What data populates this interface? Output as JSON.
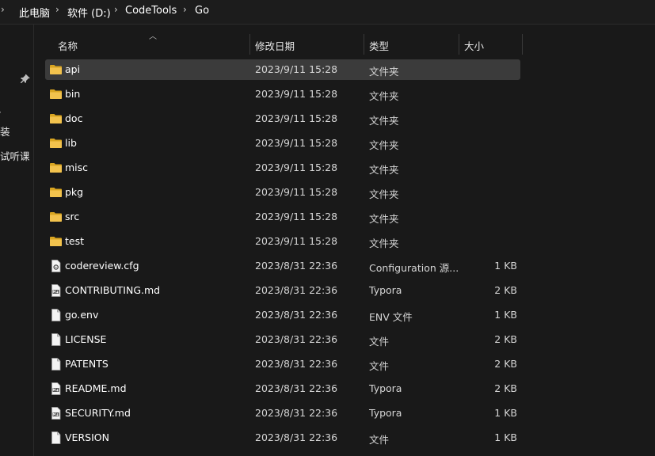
{
  "breadcrumb": {
    "items": [
      "此电脑",
      "软件 (D:)",
      "CodeTools",
      "Go"
    ],
    "separator": "›"
  },
  "left_pane": {
    "items": [
      "装",
      "试听课"
    ]
  },
  "columns": {
    "name": "名称",
    "date": "修改日期",
    "type": "类型",
    "size": "大小"
  },
  "files": [
    {
      "name": "api",
      "date": "2023/9/11 15:28",
      "type": "文件夹",
      "size": "",
      "icon": "folder-icon",
      "selected": true
    },
    {
      "name": "bin",
      "date": "2023/9/11 15:28",
      "type": "文件夹",
      "size": "",
      "icon": "folder-icon"
    },
    {
      "name": "doc",
      "date": "2023/9/11 15:28",
      "type": "文件夹",
      "size": "",
      "icon": "folder-icon"
    },
    {
      "name": "lib",
      "date": "2023/9/11 15:28",
      "type": "文件夹",
      "size": "",
      "icon": "folder-icon"
    },
    {
      "name": "misc",
      "date": "2023/9/11 15:28",
      "type": "文件夹",
      "size": "",
      "icon": "folder-icon"
    },
    {
      "name": "pkg",
      "date": "2023/9/11 15:28",
      "type": "文件夹",
      "size": "",
      "icon": "folder-icon"
    },
    {
      "name": "src",
      "date": "2023/9/11 15:28",
      "type": "文件夹",
      "size": "",
      "icon": "folder-icon"
    },
    {
      "name": "test",
      "date": "2023/9/11 15:28",
      "type": "文件夹",
      "size": "",
      "icon": "folder-icon"
    },
    {
      "name": "codereview.cfg",
      "date": "2023/8/31 22:36",
      "type": "Configuration 源...",
      "size": "1 KB",
      "icon": "config-file-icon"
    },
    {
      "name": "CONTRIBUTING.md",
      "date": "2023/8/31 22:36",
      "type": "Typora",
      "size": "2 KB",
      "icon": "markdown-file-icon"
    },
    {
      "name": "go.env",
      "date": "2023/8/31 22:36",
      "type": "ENV 文件",
      "size": "1 KB",
      "icon": "file-icon"
    },
    {
      "name": "LICENSE",
      "date": "2023/8/31 22:36",
      "type": "文件",
      "size": "2 KB",
      "icon": "file-icon"
    },
    {
      "name": "PATENTS",
      "date": "2023/8/31 22:36",
      "type": "文件",
      "size": "2 KB",
      "icon": "file-icon"
    },
    {
      "name": "README.md",
      "date": "2023/8/31 22:36",
      "type": "Typora",
      "size": "2 KB",
      "icon": "markdown-file-icon"
    },
    {
      "name": "SECURITY.md",
      "date": "2023/8/31 22:36",
      "type": "Typora",
      "size": "1 KB",
      "icon": "markdown-file-icon"
    },
    {
      "name": "VERSION",
      "date": "2023/8/31 22:36",
      "type": "文件",
      "size": "1 KB",
      "icon": "file-icon"
    }
  ],
  "colors": {
    "background": "#191919",
    "selected_row": "#3b3b3b",
    "folder_yellow": "#f2c24d"
  }
}
